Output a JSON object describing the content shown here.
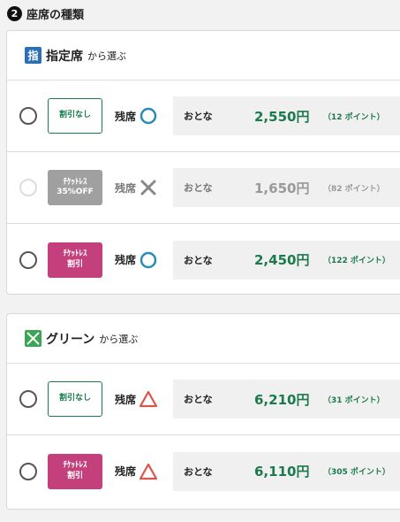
{
  "section": {
    "number": "2",
    "title": "座席の種類"
  },
  "groups": [
    {
      "icon_text": "指",
      "name": "指定席",
      "suffix": "から選ぶ",
      "rows": [
        {
          "badge": "割引なし",
          "avail_label": "残席",
          "avail_icon": "circle-icon",
          "age": "おとな",
          "price": "2,550円",
          "points": "（12 ポイント）"
        },
        {
          "badge": "ﾁｹｯﾄﾚｽ\n35%OFF",
          "avail_label": "残席",
          "avail_icon": "cross-icon",
          "age": "おとな",
          "price": "1,650円",
          "points": "（82 ポイント）"
        },
        {
          "badge": "ﾁｹｯﾄﾚｽ\n割引",
          "avail_label": "残席",
          "avail_icon": "circle-icon",
          "age": "おとな",
          "price": "2,450円",
          "points": "（122 ポイント）"
        }
      ]
    },
    {
      "name": "グリーン",
      "suffix": "から選ぶ",
      "rows": [
        {
          "badge": "割引なし",
          "avail_label": "残席",
          "avail_icon": "triangle-icon",
          "age": "おとな",
          "price": "6,210円",
          "points": "（31 ポイント）"
        },
        {
          "badge": "ﾁｹｯﾄﾚｽ\n割引",
          "avail_label": "残席",
          "avail_icon": "triangle-icon",
          "age": "おとな",
          "price": "6,110円",
          "points": "（305 ポイント）"
        }
      ]
    }
  ],
  "colors": {
    "brand_green": "#1a7a4c",
    "magenta": "#c4407c",
    "circle_blue": "#2a8bb5",
    "triangle_red": "#d9534f",
    "cross_gray": "#888888"
  }
}
